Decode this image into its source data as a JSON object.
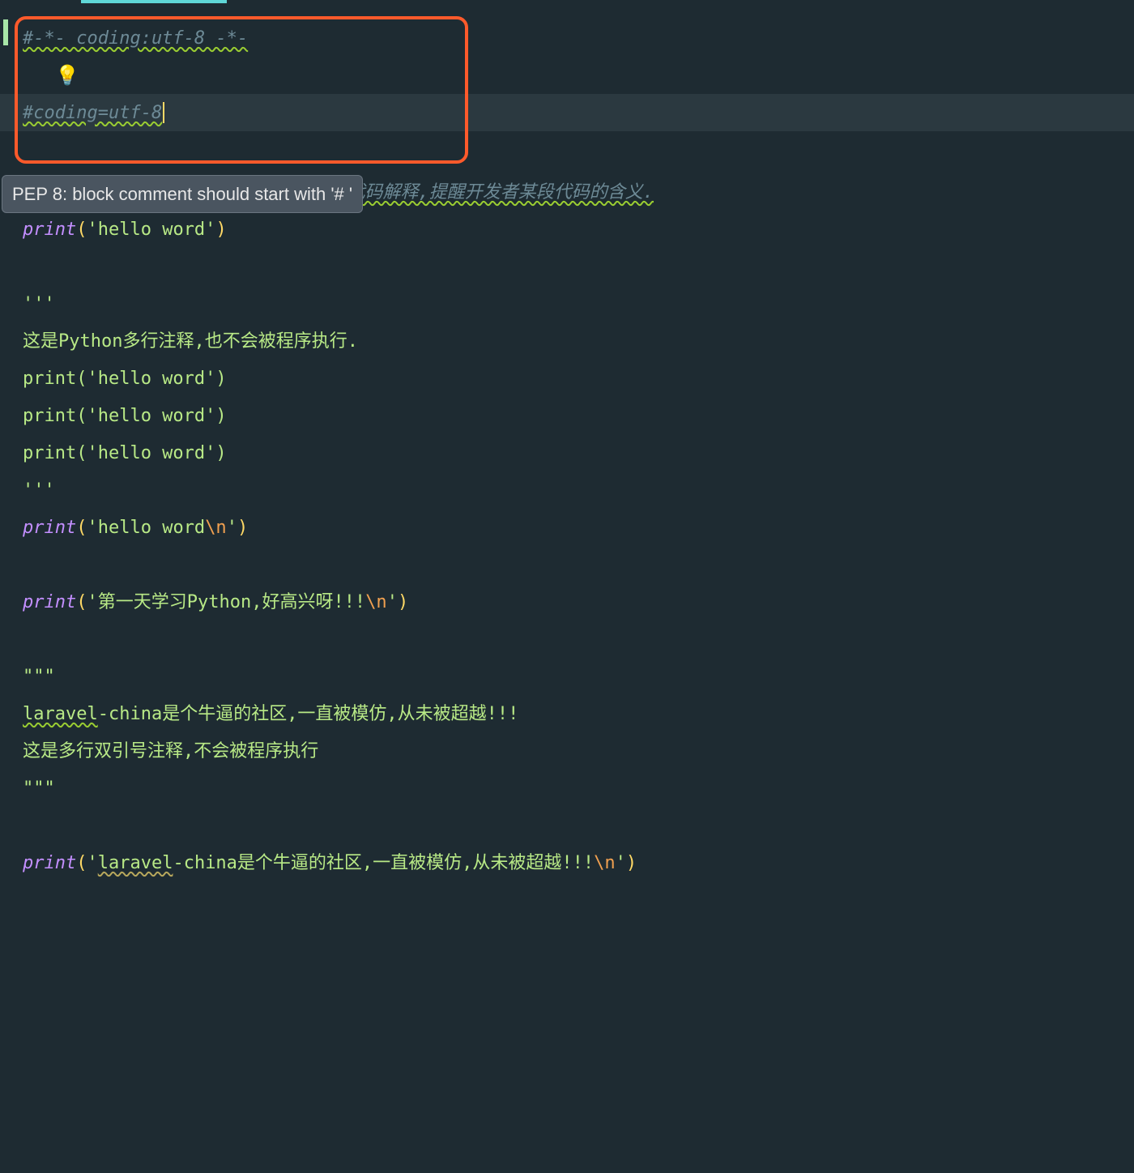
{
  "tooltip": "PEP 8: block comment should start with '# '",
  "lines": {
    "l1": "#-*- coding:utf-8 -*-",
    "l2_icon": "💡",
    "l3": "#coding=utf-8",
    "l4": "#注释不会与程序有任何关系,只是对程序代码解释,提醒开发者某段代码的含义.",
    "l5_kw": "print",
    "l5_str": "'hello word'",
    "l6": "'''",
    "l7": "这是Python多行注释,也不会被程序执行.",
    "l8": "print('hello word')",
    "l9": "print('hello word')",
    "l10": "print('hello word')",
    "l11": "'''",
    "l12_kw": "print",
    "l12_str": "'hello word",
    "l12_esc": "\\n",
    "l12_end": "'",
    "l13_kw": "print",
    "l13_str": "'第一天学习Python,好高兴呀!!!",
    "l13_esc": "\\n",
    "l13_end": "'",
    "l14": "\"\"\"",
    "l15a": "laravel",
    "l15b": "-china是个牛逼的社区,一直被模仿,从未被超越!!!",
    "l16": "这是多行双引号注释,不会被程序执行",
    "l17": "\"\"\"",
    "l18_kw": "print",
    "l18_s1": "'",
    "l18_s2": "laravel",
    "l18_s3": "-china是个牛逼的社区,一直被模仿,从未被超越!!!",
    "l18_esc": "\\n",
    "l18_end": "'"
  }
}
